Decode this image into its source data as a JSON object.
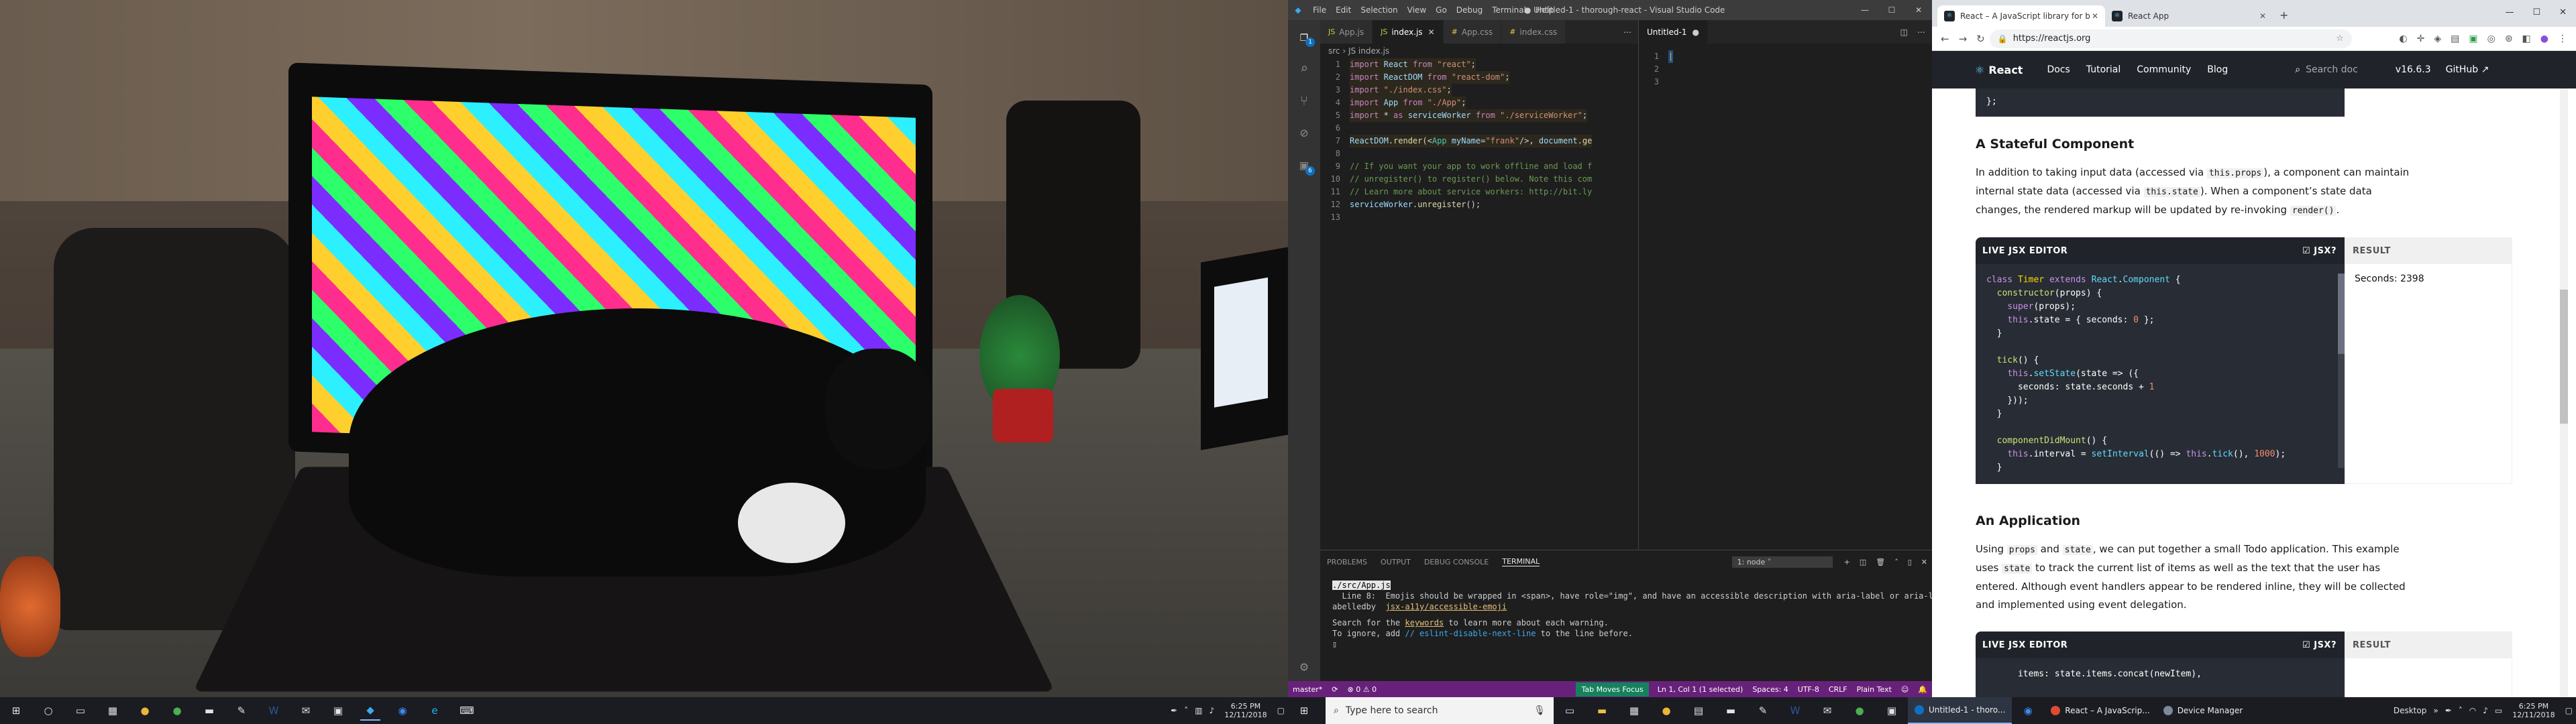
{
  "photo": {
    "description_icon": "camera-photo"
  },
  "taskbar_left": {
    "time": "6:25 PM",
    "date": "12/11/2018"
  },
  "vscode": {
    "title": "● Untitled-1 - thorough-react - Visual Studio Code",
    "menu": [
      "File",
      "Edit",
      "Selection",
      "View",
      "Go",
      "Debug",
      "Terminal",
      "Help"
    ],
    "tabs_left": [
      {
        "label": "App.js",
        "active": false
      },
      {
        "label": "index.js",
        "active": true
      },
      {
        "label": "App.css",
        "active": false
      },
      {
        "label": "index.css",
        "active": false
      }
    ],
    "tab_right": "Untitled-1",
    "breadcrumb": "src › JS index.js",
    "code_lines": [
      {
        "n": "1",
        "html": "<span class='k'>import</span> <span class='v'>React</span> <span class='k'>from</span> <span class='s'>\"react\"</span>;"
      },
      {
        "n": "2",
        "html": "<span class='k'>import</span> <span class='v'>ReactDOM</span> <span class='k'>from</span> <span class='s'>\"react-dom\"</span>;"
      },
      {
        "n": "3",
        "html": "<span class='k'>import</span> <span class='s'>\"./index.css\"</span>;"
      },
      {
        "n": "4",
        "html": "<span class='k'>import</span> <span class='v'>App</span> <span class='k'>from</span> <span class='s'>\"./App\"</span>;"
      },
      {
        "n": "5",
        "html": "<span class='k'>import</span> * <span class='k'>as</span> <span class='v'>serviceWorker</span> <span class='k'>from</span> <span class='s'>\"./serviceWorker\"</span>;"
      },
      {
        "n": "6",
        "html": ""
      },
      {
        "n": "7",
        "html": "<span class='v'>ReactDOM</span>.<span class='f'>render</span>(&lt;<span class='g'>App</span> <span class='v'>myName</span>=<span class='s'>\"frank\"</span>/&gt;, <span class='v'>document</span>.<span class='f'>ge</span>"
      },
      {
        "n": "8",
        "html": ""
      },
      {
        "n": "9",
        "html": "<span class='c'>// If you want your app to work offline and load f</span>"
      },
      {
        "n": "10",
        "html": "<span class='c'>// unregister() to register() below. Note this com</span>"
      },
      {
        "n": "11",
        "html": "<span class='c'>// Learn more about service workers: http://bit.ly</span>"
      },
      {
        "n": "12",
        "html": "<span class='v'>serviceWorker</span>.<span class='f'>unregister</span>();"
      },
      {
        "n": "13",
        "html": ""
      }
    ],
    "right_lines": [
      "1",
      "2",
      "3"
    ],
    "panel_tabs": [
      "PROBLEMS",
      "OUTPUT",
      "DEBUG CONSOLE",
      "TERMINAL"
    ],
    "terminal_select": "1: node",
    "terminal": {
      "file": "./src/App.js",
      "line1": "  Line 8:  Emojis should be wrapped in <span>, have role=\"img\", and have an accessible description with aria-label or aria-l",
      "line2": "abelledby  ",
      "link1": "jsx-a11y/accessible-emoji",
      "line3": "Search for the ",
      "keywords": "keywords",
      "line3b": " to learn more about each warning.",
      "line4": "To ignore, add ",
      "disable": "// eslint-disable-next-line",
      "line4b": " to the line before."
    },
    "status": {
      "branch": "master*",
      "errors": "⊗ 0 ⚠ 0",
      "tab_focus": "Tab Moves Focus",
      "position": "Ln 1, Col 1 (1 selected)",
      "spaces": "Spaces: 4",
      "encoding": "UTF-8",
      "eol": "CRLF",
      "language": "Plain Text"
    }
  },
  "chrome": {
    "tabs": [
      {
        "label": "React – A JavaScript library for b",
        "active": true
      },
      {
        "label": "React App",
        "active": false
      }
    ],
    "url": "https://reactjs.org",
    "nav": {
      "logo": "React",
      "links": [
        "Docs",
        "Tutorial",
        "Community",
        "Blog"
      ],
      "search_placeholder": "Search doc",
      "version": "v16.6.3",
      "github": "GitHub ↗"
    },
    "top_code": "};",
    "section1": {
      "title": "A Stateful Component",
      "p1": "In addition to taking input data (accessed via ",
      "c1": "this.props",
      "p2": "), a component can maintain internal state data (accessed via ",
      "c2": "this.state",
      "p3": "). When a component’s state data changes, the rendered markup will be updated by re-invoking ",
      "c3": "render()",
      "p4": "."
    },
    "editor1": {
      "label": "LIVE JSX EDITOR",
      "jsx": "☑ JSX?",
      "result": "RESULT",
      "result_text": "Seconds: 2398"
    },
    "section2": {
      "title": "An Application",
      "p1": "Using ",
      "c1": "props",
      "p2": " and ",
      "c2": "state",
      "p3": ", we can put together a small Todo application. This example uses ",
      "c3": "state",
      "p4": " to track the current list of items as well as the text that the user has entered. Although event handlers appear to be rendered inline, they will be collected and implemented using event delegation."
    },
    "editor2": {
      "label": "LIVE JSX EDITOR",
      "jsx": "☑ JSX?",
      "result": "RESULT",
      "code": "items: state.items.concat(newItem),"
    }
  },
  "taskbar_right": {
    "search": "Type here to search",
    "apps": [
      {
        "label": "Untitled-1 - thoro...",
        "color": "#0e70c0",
        "active": true
      },
      {
        "label": "React – A JavaScrip...",
        "color": "#e04a2f",
        "active": false
      },
      {
        "label": "Device Manager",
        "color": "#7a8a9a",
        "active": false
      }
    ],
    "desktop": "Desktop",
    "time": "6:25 PM",
    "date": "12/11/2018"
  }
}
